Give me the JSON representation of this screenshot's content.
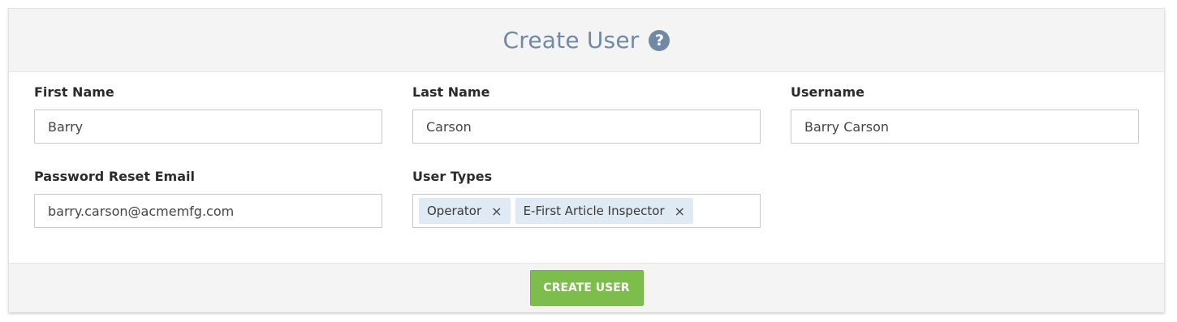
{
  "header": {
    "title": "Create User",
    "help_icon": "question-circle-icon",
    "help_glyph": "?"
  },
  "form": {
    "first_name": {
      "label": "First Name",
      "value": "Barry"
    },
    "last_name": {
      "label": "Last Name",
      "value": "Carson"
    },
    "username": {
      "label": "Username",
      "value": "Barry Carson"
    },
    "password_reset_email": {
      "label": "Password Reset Email",
      "value": "barry.carson@acmemfg.com"
    },
    "user_types": {
      "label": "User Types",
      "tags": [
        {
          "label": "Operator",
          "remove": "×"
        },
        {
          "label": "E-First Article Inspector",
          "remove": "×"
        }
      ]
    }
  },
  "footer": {
    "create_label": "CREATE USER"
  },
  "colors": {
    "accent": "#6f89a6",
    "button_green": "#7dbd4c",
    "tag_background": "#dfeaf5"
  }
}
